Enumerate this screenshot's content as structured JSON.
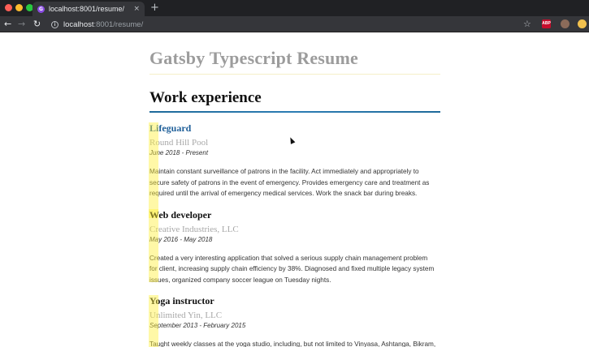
{
  "browser": {
    "tab_title": "localhost:8001/resume/",
    "tab_close": "×",
    "new_tab": "+",
    "url_host": "localhost",
    "url_path": ":8001/resume/",
    "ext_abp_label": "ABP"
  },
  "page": {
    "site_title": "Gatsby Typescript Resume",
    "section_title": "Work experience",
    "jobs": [
      {
        "title": "Lifeguard",
        "company": "Round Hill Pool",
        "dates": "June 2018 - Present",
        "description": "Maintain constant surveillance of patrons in the facility. Act immediately and appropriately to secure safety of patrons in the event of emergency. Provides emergency care and treatment as required until the arrival of emergency medical services. Work the snack bar during breaks."
      },
      {
        "title": "Web developer",
        "company": "Creative Industries, LLC",
        "dates": "May 2016 - May 2018",
        "description": "Created a very interesting application that solved a serious supply chain management problem for client, increasing supply chain efficiency by 38%. Diagnosed and fixed multiple legacy system issues, organized company soccer league on Tuesday nights."
      },
      {
        "title": "Yoga instructor",
        "company": "Unlimited Yin, LLC",
        "dates": "September 2013 - February 2015",
        "description": "Taught weekly classes at the yoga studio, including, but not limited to Vinyasa, Ashtanga, Bikram, Hatha, Iyengar, restorative and yin yoga."
      }
    ]
  },
  "colors": {
    "accent": "#1f5f99",
    "rule": "#2b7cb3",
    "highlight": "#fff03c"
  }
}
